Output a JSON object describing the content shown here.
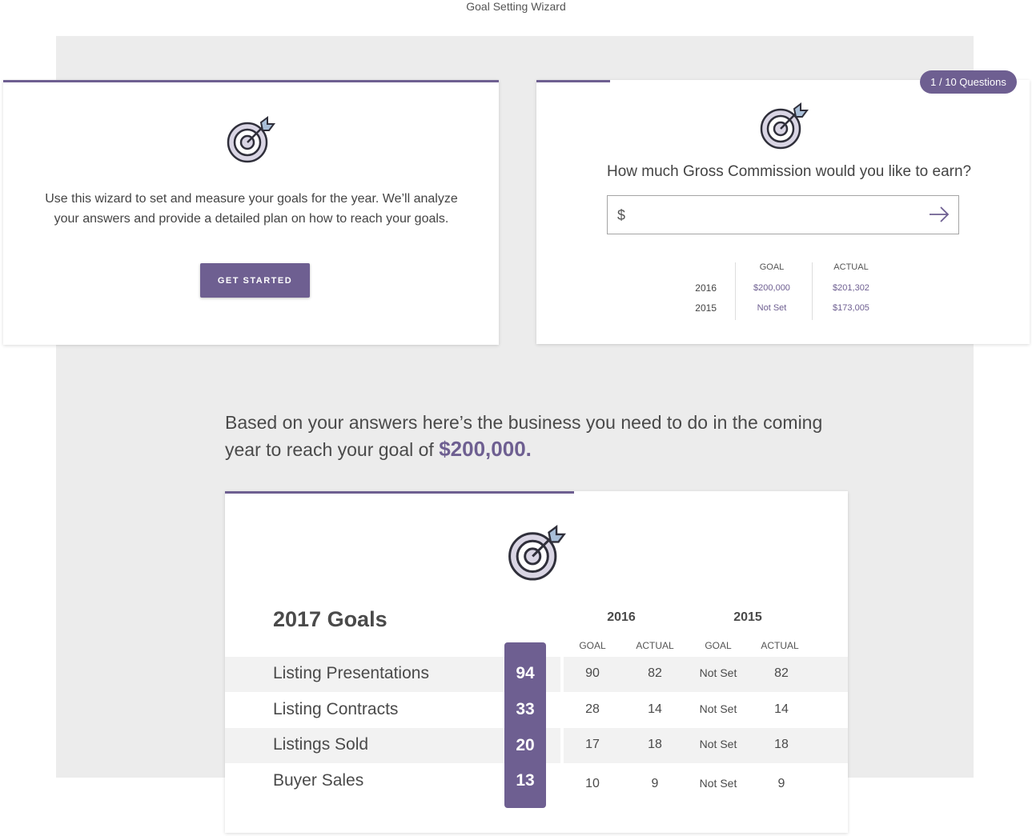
{
  "page": {
    "title": "Goal Setting Wizard"
  },
  "intro_card": {
    "text": "Use this wizard to set and measure your goals for the year. We’ll analyze your answers and provide a detailed plan on how to reach your goals.",
    "button_label": "GET STARTED",
    "icon": "target-icon"
  },
  "question_card": {
    "badge": "1 / 10  Questions",
    "question": "How much Gross Commission would you like to earn?",
    "currency_symbol": "$",
    "input_value": "",
    "input_placeholder": "",
    "submit_icon": "arrow-right-icon",
    "history": {
      "headers": [
        "GOAL",
        "ACTUAL"
      ],
      "rows": [
        {
          "year": "2016",
          "goal": "$200,000",
          "actual": "$201,302"
        },
        {
          "year": "2015",
          "goal": "Not Set",
          "actual": "$173,005"
        }
      ]
    }
  },
  "summary": {
    "text": "Based on your answers here’s the business you need to do in the coming year to reach your goal of ",
    "amount": "$200,000."
  },
  "goals_card": {
    "title": "2017 Goals",
    "years": [
      "2016",
      "2015"
    ],
    "sub_headers": [
      "GOAL",
      "ACTUAL",
      "GOAL",
      "ACTUAL"
    ],
    "rows": [
      {
        "label": "Listing Presentations",
        "target": "94",
        "g2016": "90",
        "a2016": "82",
        "g2015": "Not Set",
        "a2015": "82"
      },
      {
        "label": "Listing Contracts",
        "target": "33",
        "g2016": "28",
        "a2016": "14",
        "g2015": "Not Set",
        "a2015": "14"
      },
      {
        "label": "Listings Sold",
        "target": "20",
        "g2016": "17",
        "a2016": "18",
        "g2015": "Not Set",
        "a2015": "18"
      },
      {
        "label": "Buyer Sales",
        "target": "13",
        "g2016": "10",
        "a2016": "9",
        "g2015": "Not Set",
        "a2015": "9"
      }
    ]
  },
  "colors": {
    "accent": "#6e5f91",
    "panel": "#ececec",
    "row_shade": "#f2f2f2"
  }
}
